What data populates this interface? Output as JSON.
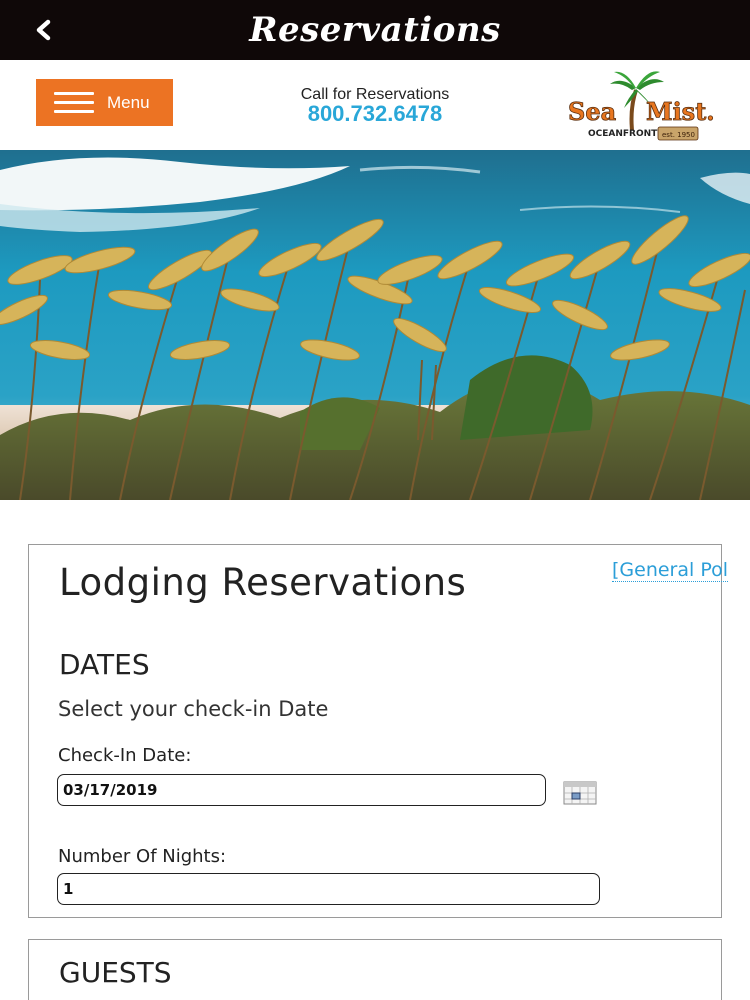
{
  "app": {
    "title": "Reservations"
  },
  "header": {
    "menu_label": "Menu",
    "call_label": "Call for Reservations",
    "phone": "800.732.6478",
    "logo": {
      "brand": "SeaMist.",
      "tagline": "OCEANFRONT",
      "established": "est. 1950",
      "colors": {
        "orange": "#e8761f",
        "green": "#2e8b2e",
        "tan": "#c9a46a"
      }
    }
  },
  "form": {
    "title": "Lodging Reservations",
    "policy_link": "[General Pol",
    "dates_heading": "DATES",
    "dates_subheading": "Select your check-in Date",
    "checkin_label": "Check-In Date:",
    "checkin_value": "03/17/2019",
    "nights_label": "Number Of Nights:",
    "nights_value": "1",
    "guests_heading": "GUESTS"
  },
  "colors": {
    "menu_button": "#ec7323",
    "phone_text": "#29a7d8",
    "link_text": "#2b9ed8",
    "titlebar_bg": "#0f0808"
  },
  "icons": {
    "back": "chevron-left-icon",
    "menu": "hamburger-icon",
    "calendar": "calendar-icon"
  }
}
